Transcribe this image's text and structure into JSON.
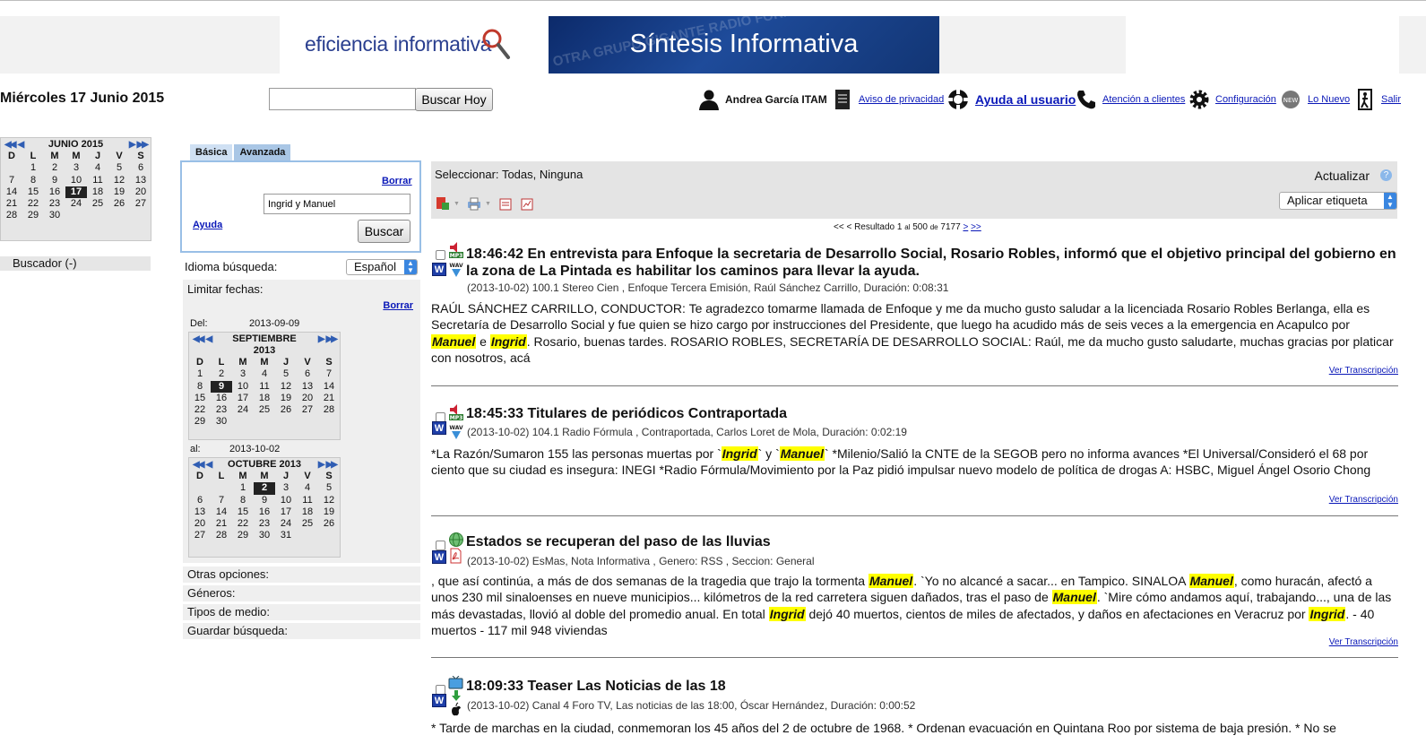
{
  "header": {
    "logo_text": "eficiencia informativa",
    "brand_title": "Síntesis Informativa",
    "brand_bg_text": "OTRA GRUPO GIGANTE RADIO FÓRMULA IPC INTERÉS NACIONAL DÓLAR EN INFLACIÓN POTENCIAL DESCANSO OTRA EFICIENCIA"
  },
  "date_title": "Miércoles 17 Junio 2015",
  "today_search": {
    "value": "",
    "button": "Buscar Hoy"
  },
  "user_bar": {
    "user_name": "Andrea García ITAM",
    "privacy": "Aviso de privacidad",
    "help": "Ayuda al usuario",
    "support": "Atención a clientes",
    "config": "Configuración",
    "new": "Lo Nuevo",
    "exit": "Salir"
  },
  "main_calendar": {
    "month": "JUNIO 2015",
    "dow": [
      "D",
      "L",
      "M",
      "M",
      "J",
      "V",
      "S"
    ],
    "days": [
      "",
      "1",
      "2",
      "3",
      "4",
      "5",
      "6",
      "7",
      "8",
      "9",
      "10",
      "11",
      "12",
      "13",
      "14",
      "15",
      "16",
      "17",
      "18",
      "19",
      "20",
      "21",
      "22",
      "23",
      "24",
      "25",
      "26",
      "27",
      "28",
      "29",
      "30",
      "",
      "",
      "",
      ""
    ],
    "selected": "17"
  },
  "buscador_label": "Buscador (-)",
  "search": {
    "tabs": [
      "Básica",
      "Avanzada"
    ],
    "clear": "Borrar",
    "query": "Ingrid y Manuel",
    "help": "Ayuda",
    "button": "Buscar",
    "lang_label": "Idioma búsqueda:",
    "lang_value": "Español",
    "limit_label": "Limitar fechas:",
    "clear_dates": "Borrar",
    "from_label": "Del:",
    "from_value": "2013-09-09",
    "to_label": "al:",
    "to_value": "2013-10-02"
  },
  "cal_from": {
    "month": "SEPTIEMBRE",
    "year": "2013",
    "dow": [
      "D",
      "L",
      "M",
      "M",
      "J",
      "V",
      "S"
    ],
    "days": [
      "1",
      "2",
      "3",
      "4",
      "5",
      "6",
      "7",
      "8",
      "9",
      "10",
      "11",
      "12",
      "13",
      "14",
      "15",
      "16",
      "17",
      "18",
      "19",
      "20",
      "21",
      "22",
      "23",
      "24",
      "25",
      "26",
      "27",
      "28",
      "29",
      "30",
      "",
      "",
      "",
      "",
      ""
    ],
    "selected": "9"
  },
  "cal_to": {
    "month": "OCTUBRE 2013",
    "dow": [
      "D",
      "L",
      "M",
      "M",
      "J",
      "V",
      "S"
    ],
    "days": [
      "",
      "",
      "1",
      "2",
      "3",
      "4",
      "5",
      "6",
      "7",
      "8",
      "9",
      "10",
      "11",
      "12",
      "13",
      "14",
      "15",
      "16",
      "17",
      "18",
      "19",
      "20",
      "21",
      "22",
      "23",
      "24",
      "25",
      "26",
      "27",
      "28",
      "29",
      "30",
      "31",
      "",
      ""
    ],
    "selected": "2"
  },
  "options": [
    "Otras opciones:",
    "Géneros:",
    "Tipos de medio:",
    "Guardar búsqueda:"
  ],
  "results": {
    "select_prefix": "Seleccionar:",
    "select_all": "Todas",
    "select_none": "Ninguna",
    "refresh": "Actualizar",
    "apply_label": "Aplicar etiqueta",
    "pager_prefix": "<< < Resultado",
    "pager_from": "1",
    "pager_to": "500",
    "pager_total": "7177",
    "pager_next": ">",
    "pager_last": ">>",
    "view_transcript": "Ver Transcripción",
    "items": [
      {
        "title": "18:46:42 En entrevista para Enfoque la secretaria de Desarrollo Social, Rosario Robles, informó que el objetivo principal del gobierno en la zona de La Pintada es habilitar los caminos para llevar la ayuda.",
        "meta": "(2013-10-02) 100.1 Stereo Cien , Enfoque Tercera Emisión, Raúl Sánchez Carrillo, Duración: 0:08:31",
        "body": [
          "RAÚL SÁNCHEZ CARRILLO, CONDUCTOR: Te agradezco tomarme llamada de Enfoque y me da mucho gusto saludar a la licenciada Rosario Robles Berlanga, ella es Secretaría de Desarrollo Social y fue quien se hizo cargo por instrucciones del Presidente, que luego ha acudido más de seis veces a la emergencia en Acapulco por ",
          "Manuel",
          " e ",
          "Ingrid",
          ". Rosario, buenas tardes. ROSARIO ROBLES, SECRETARÍA DE DESARROLLO SOCIAL: Raúl, me da mucho gusto saludarte, muchas gracias por platicar con nosotros, acá"
        ]
      },
      {
        "title": "18:45:33 Titulares de periódicos Contraportada",
        "meta": "(2013-10-02) 104.1 Radio Fórmula , Contraportada, Carlos Loret de Mola, Duración: 0:02:19",
        "body": [
          "*La Razón/Sumaron 155 las personas muertas por `",
          "Ingrid",
          "` y `",
          "Manuel",
          "` *Milenio/Salió la CNTE de la SEGOB pero no informa avances *El Universal/Consideró el 68 por ciento que su ciudad es insegura: INEGI *Radio Fórmula/Movimiento por la Paz pidió impulsar nuevo modelo de política de drogas A: HSBC, Miguel Ángel Osorio Chong"
        ]
      },
      {
        "title": "Estados se recuperan del paso de las lluvias",
        "meta": "(2013-10-02) EsMas, Nota Informativa , Genero: RSS , Seccion: General",
        "body": [
          ", que así continúa, a más de dos semanas de la tragedia que trajo la tormenta ",
          "Manuel",
          ". `Yo no alcancé a sacar... en Tampico. SINALOA ",
          "Manuel",
          ", como huracán, afectó a unos 230 mil sinaloenses en nueve municipios... kilómetros de la red carretera siguen dañados, tras el paso de ",
          "Manuel",
          ". `Mire cómo andamos aquí, trabajando..., una de las más devastadas, llovió al doble del promedio anual. En total ",
          "Ingrid",
          " dejó 40 muertos, cientos de miles de afectados, y daños en afectaciones en Veracruz por ",
          "Ingrid",
          ". - 40 muertos - 117 mil 948 viviendas"
        ]
      },
      {
        "title": "18:09:33 Teaser Las Noticias de las 18",
        "meta": "(2013-10-02) Canal 4 Foro TV, Las noticias de las 18:00, Óscar Hernández, Duración: 0:00:52",
        "body": [
          "* Tarde de marchas en la ciudad, conmemoran los 45 años del 2 de octubre de 1968. * Ordenan evacuación en Quintana Roo por sistema de baja presión. * No se"
        ]
      }
    ]
  },
  "colors": {
    "highlight": "#ffff00",
    "link": "#0a18b8",
    "panel": "#e6e6e6",
    "brand": "#123574"
  }
}
